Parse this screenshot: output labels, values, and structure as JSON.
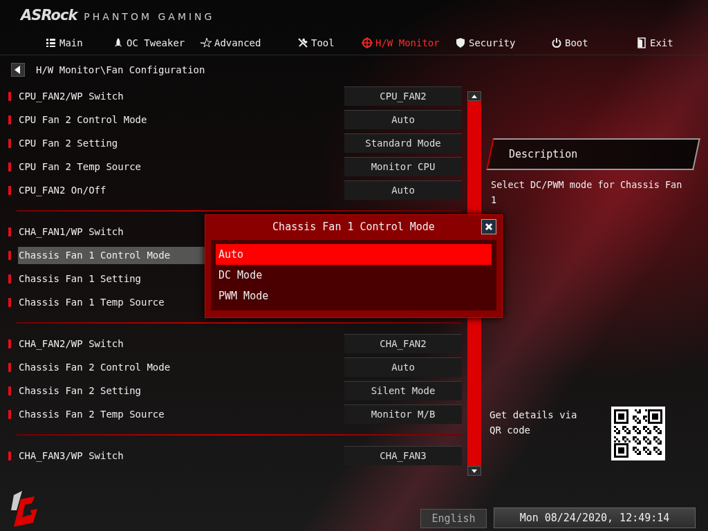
{
  "brand": {
    "name": "ASRock",
    "tagline": "PHANTOM GAMING"
  },
  "tabs": [
    {
      "label": "Main",
      "selected": false
    },
    {
      "label": "OC Tweaker",
      "selected": false
    },
    {
      "label": "Advanced",
      "selected": false
    },
    {
      "label": "Tool",
      "selected": false
    },
    {
      "label": "H/W Monitor",
      "selected": true
    },
    {
      "label": "Security",
      "selected": false
    },
    {
      "label": "Boot",
      "selected": false
    },
    {
      "label": "Exit",
      "selected": false
    }
  ],
  "breadcrumb": "H/W Monitor\\Fan Configuration",
  "groups": [
    [
      {
        "label": "CPU_FAN2/WP Switch",
        "value": "CPU_FAN2",
        "selected": false
      },
      {
        "label": "CPU Fan 2 Control Mode",
        "value": "Auto",
        "selected": false
      },
      {
        "label": "CPU Fan 2 Setting",
        "value": "Standard Mode",
        "selected": false
      },
      {
        "label": "CPU Fan 2 Temp Source",
        "value": "Monitor CPU",
        "selected": false
      },
      {
        "label": "CPU_FAN2 On/Off",
        "value": "Auto",
        "selected": false
      }
    ],
    [
      {
        "label": "CHA_FAN1/WP Switch",
        "selected": false
      },
      {
        "label": "Chassis Fan 1 Control Mode",
        "selected": true
      },
      {
        "label": "Chassis Fan 1 Setting",
        "selected": false
      },
      {
        "label": "Chassis Fan 1 Temp Source",
        "selected": false
      }
    ],
    [
      {
        "label": "CHA_FAN2/WP Switch",
        "value": "CHA_FAN2",
        "selected": false
      },
      {
        "label": "Chassis Fan 2 Control Mode",
        "value": "Auto",
        "selected": false
      },
      {
        "label": "Chassis Fan 2 Setting",
        "value": "Silent Mode",
        "selected": false
      },
      {
        "label": "Chassis Fan 2 Temp Source",
        "value": "Monitor M/B",
        "selected": false
      }
    ],
    [
      {
        "label": "CHA_FAN3/WP Switch",
        "value": "CHA_FAN3",
        "selected": false
      }
    ]
  ],
  "description": {
    "title": "Description",
    "text": "Select DC/PWM mode for Chassis Fan 1"
  },
  "qr": {
    "text": "Get details via QR code"
  },
  "popup": {
    "title": "Chassis Fan 1 Control Mode",
    "options": [
      {
        "label": "Auto",
        "selected": true
      },
      {
        "label": "DC Mode",
        "selected": false
      },
      {
        "label": "PWM Mode",
        "selected": false
      }
    ]
  },
  "footer": {
    "language": "English",
    "datetime": "Mon 08/24/2020, 12:49:14"
  }
}
